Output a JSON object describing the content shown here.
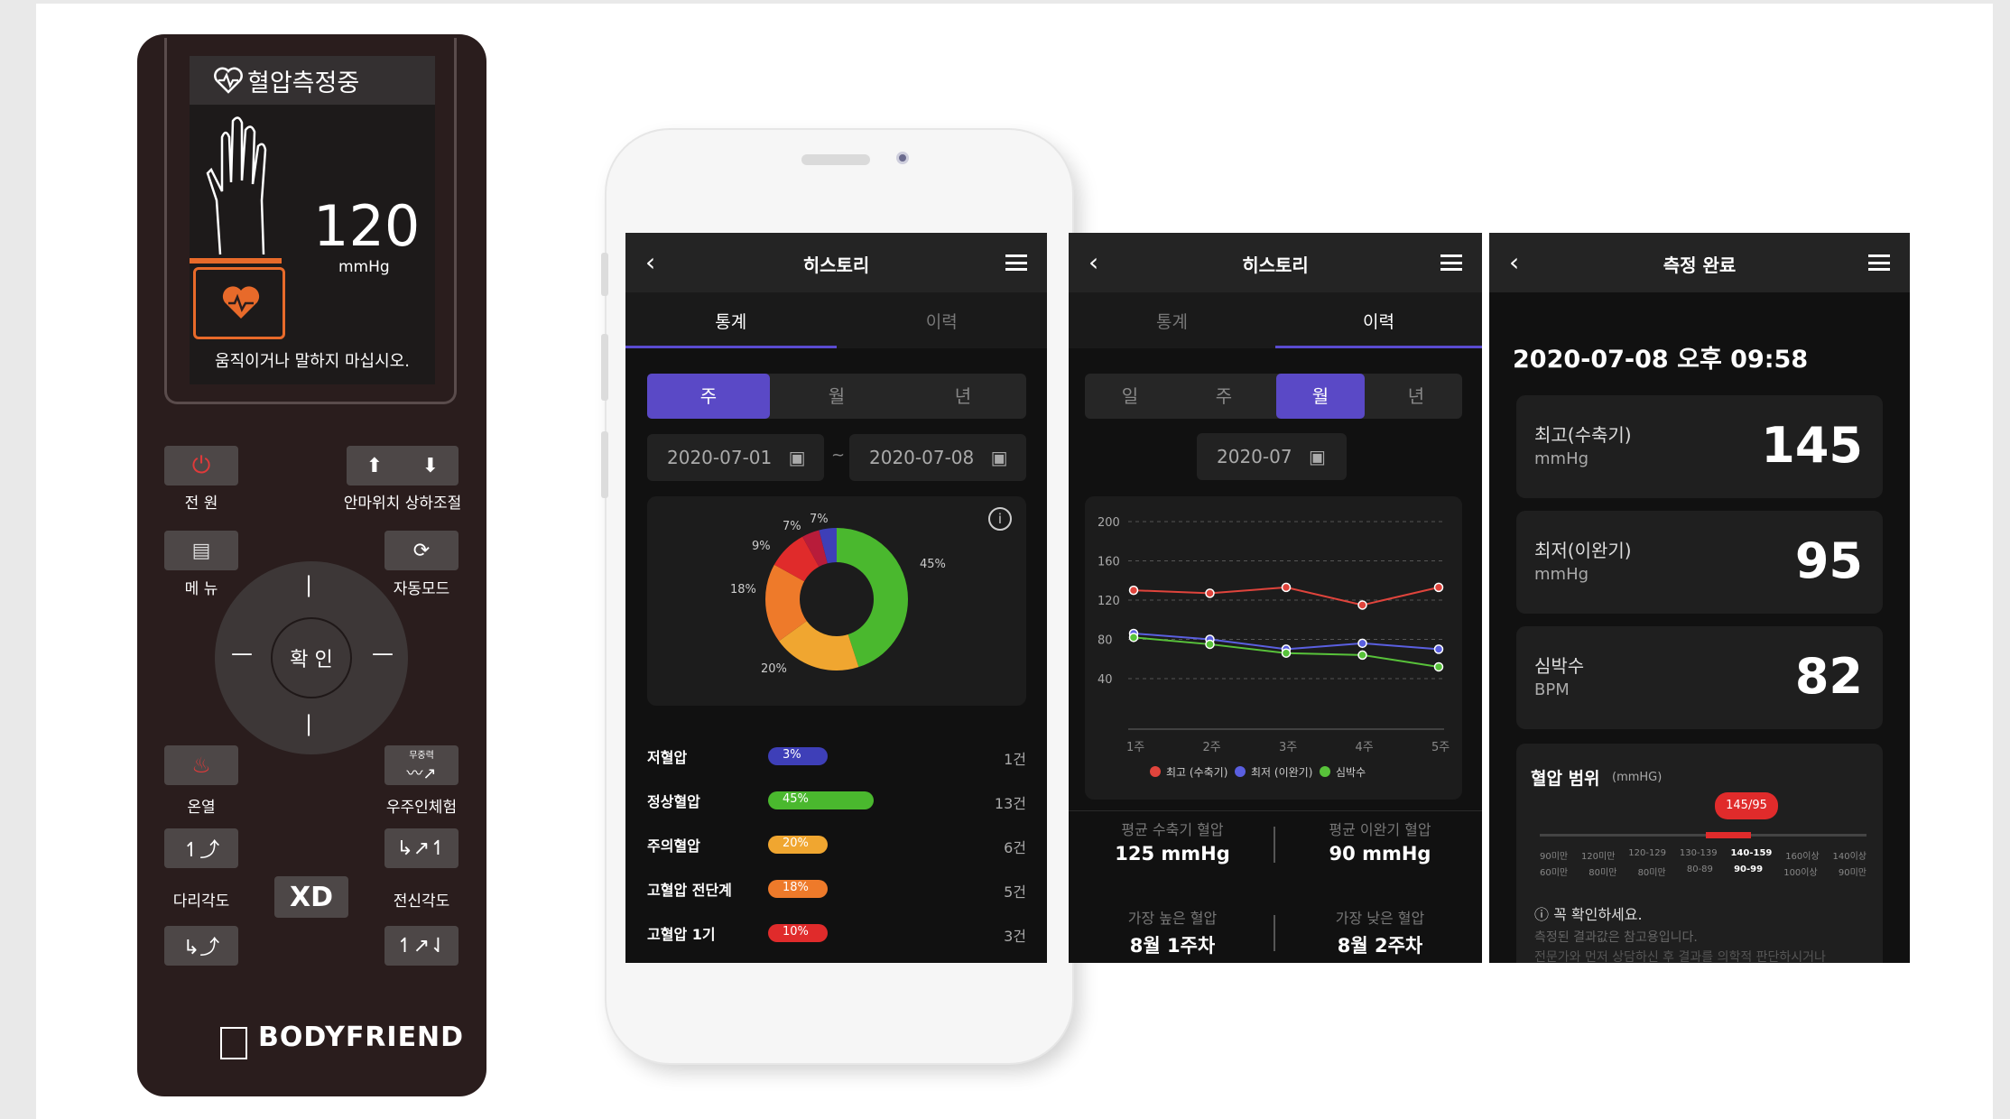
{
  "remote": {
    "lcd_title": "혈압측정중",
    "lcd_value": "120",
    "lcd_unit": "mmHg",
    "lcd_note": "움직이거나 말하지 마십시오.",
    "power_label": "전 원",
    "pillow_label": "안마위치 상하조절",
    "menu_label": "메 뉴",
    "auto_label": "자동모드",
    "confirm_label": "확 인",
    "heat_label": "온열",
    "zero_g_badge": "무중력",
    "space_label": "우주인체험",
    "leg_label": "다리각도",
    "body_label": "전신각도",
    "xd_label": "XD",
    "brand": "BODYFRIEND"
  },
  "screen1": {
    "title": "히스토리",
    "tabs": [
      "통계",
      "이력"
    ],
    "segment": [
      "주",
      "월",
      "년"
    ],
    "date_from": "2020-07-01",
    "date_sep": "~",
    "date_to": "2020-07-08",
    "donut_labels": [
      "45%",
      "20%",
      "18%",
      "9%",
      "7%",
      "7%"
    ],
    "stats": [
      {
        "name": "저혈압",
        "pct": "3%",
        "count": "1건",
        "color": "#3e3fb8",
        "value": 0.03
      },
      {
        "name": "정상혈압",
        "pct": "45%",
        "count": "13건",
        "color": "#4ab82e",
        "value": 0.45
      },
      {
        "name": "주의혈압",
        "pct": "20%",
        "count": "6건",
        "color": "#f0a630",
        "value": 0.2
      },
      {
        "name": "고혈압 전단계",
        "pct": "18%",
        "count": "5건",
        "color": "#ee7a2a",
        "value": 0.18
      },
      {
        "name": "고혈압 1기",
        "pct": "10%",
        "count": "3건",
        "color": "#e02b2b",
        "value": 0.1
      }
    ]
  },
  "screen2": {
    "title": "히스토리",
    "tabs": [
      "통계",
      "이력"
    ],
    "segment": [
      "일",
      "주",
      "월",
      "년"
    ],
    "month": "2020-07",
    "y_ticks": [
      "200",
      "160",
      "120",
      "80",
      "40"
    ],
    "x_ticks": [
      "1주",
      "2주",
      "3주",
      "4주",
      "5주"
    ],
    "legend": [
      "최고 (수축기)",
      "최저 (이완기)",
      "심박수"
    ],
    "avg_sys_label": "평균 수축기 혈압",
    "avg_sys_value": "125 mmHg",
    "avg_dia_label": "평균 이완기 혈압",
    "avg_dia_value": "90 mmHg",
    "high_label": "가장 높은 혈압",
    "high_value": "8월 1주차",
    "low_label": "가장 낮은 혈압",
    "low_value": "8월 2주차"
  },
  "screen3": {
    "title": "측정 완료",
    "datetime": "2020-07-08 오후 09:58",
    "cards": [
      {
        "name": "최고(수축기)",
        "unit": "mmHg",
        "value": "145"
      },
      {
        "name": "최저(이완기)",
        "unit": "mmHg",
        "value": "95"
      },
      {
        "name": "심박수",
        "unit": "BPM",
        "value": "82"
      }
    ],
    "range_title": "혈압 범위",
    "range_unit": "(mmHG)",
    "range_badge": "145/95",
    "range_top": [
      "90미만",
      "120미만",
      "120-129",
      "130-139",
      "140-159",
      "160이상",
      "140이상"
    ],
    "range_bottom": [
      "60미만",
      "80미만",
      "80미만",
      "80-89",
      "90-99",
      "100이상",
      "90미만"
    ],
    "notice_title": "ⓘ 꼭 확인하세요.",
    "notice_text": "측정된 결과값은 참고용입니다.",
    "notice_text2": "전문가와 먼저 상담하신 후 결과를 의학적 판단하시거나"
  },
  "chart_data": {
    "type": "line",
    "categories": [
      "1주",
      "2주",
      "3주",
      "4주",
      "5주"
    ],
    "series": [
      {
        "name": "최고 (수축기)",
        "values": [
          130,
          127,
          133,
          115,
          133
        ],
        "color": "#e0443c"
      },
      {
        "name": "최저 (이완기)",
        "values": [
          86,
          80,
          70,
          76,
          70
        ],
        "color": "#5a5fe0"
      },
      {
        "name": "심박수",
        "values": [
          82,
          75,
          66,
          64,
          52
        ],
        "color": "#58c23a"
      }
    ],
    "ylim": [
      0,
      200
    ]
  }
}
